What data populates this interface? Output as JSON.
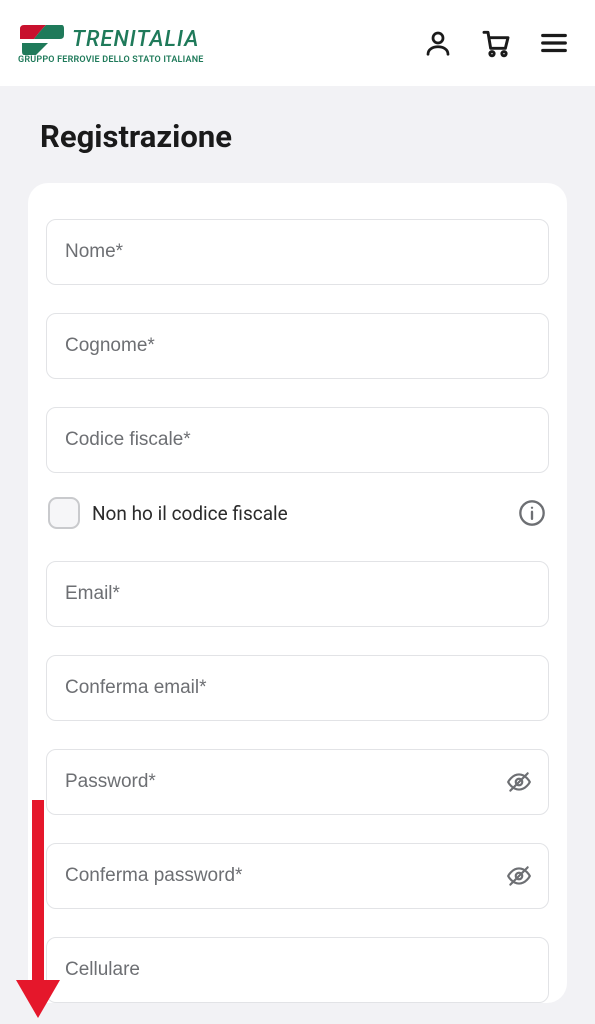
{
  "brand": {
    "name": "TRENITALIA",
    "tagline": "GRUPPO FERROVIE DELLO STATO ITALIANE",
    "accent": "#1f7a5a",
    "accent2": "#c8112e"
  },
  "page": {
    "title": "Registrazione"
  },
  "form": {
    "nome": {
      "placeholder": "Nome*"
    },
    "cognome": {
      "placeholder": "Cognome*"
    },
    "codice_fiscale": {
      "placeholder": "Codice fiscale*"
    },
    "no_cf_label": "Non ho il codice fiscale",
    "email": {
      "placeholder": "Email*"
    },
    "conferma_email": {
      "placeholder": "Conferma email*"
    },
    "password": {
      "placeholder": "Password*"
    },
    "conferma_password": {
      "placeholder": "Conferma password*"
    },
    "cellulare": {
      "placeholder": "Cellulare"
    }
  }
}
